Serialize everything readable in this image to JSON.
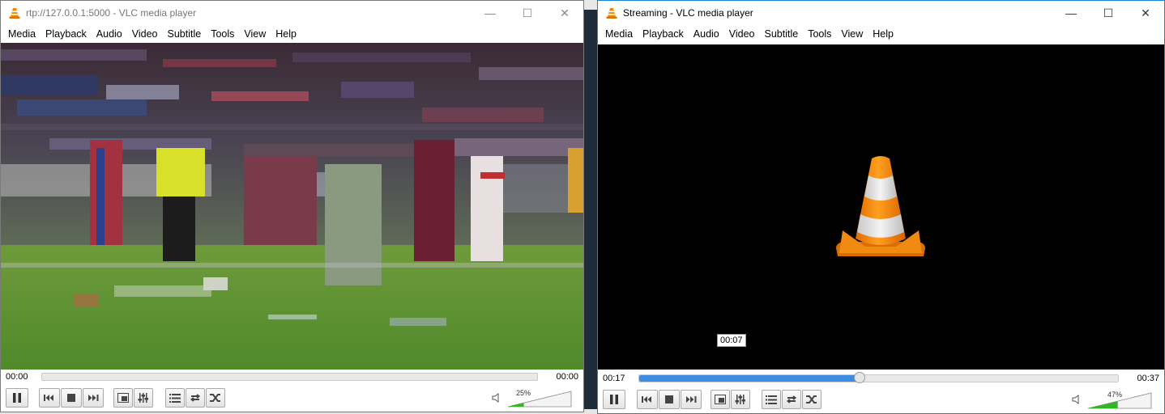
{
  "left_window": {
    "title": "rtp://127.0.0.1:5000 - VLC media player",
    "menu": [
      "Media",
      "Playback",
      "Audio",
      "Video",
      "Subtitle",
      "Tools",
      "View",
      "Help"
    ],
    "time_elapsed": "00:00",
    "time_total": "00:00",
    "seek_fraction": 0,
    "volume_label": "25%",
    "volume_fraction": 0.25
  },
  "right_window": {
    "title": "Streaming - VLC media player",
    "menu": [
      "Media",
      "Playback",
      "Audio",
      "Video",
      "Subtitle",
      "Tools",
      "View",
      "Help"
    ],
    "time_elapsed": "00:17",
    "time_total": "00:37",
    "seek_fraction": 0.46,
    "seek_tooltip": "00:07",
    "volume_label": "47%",
    "volume_fraction": 0.47
  },
  "window_controls": {
    "minimize": "—",
    "maximize": "☐",
    "close": "✕"
  },
  "colors": {
    "accent": "#3d8ee0",
    "volume_green": "#33b526",
    "vlc_orange": "#f18a00"
  },
  "icons": [
    "vlc-cone-icon",
    "pause-icon",
    "previous-icon",
    "stop-icon",
    "next-icon",
    "fullscreen-icon",
    "extended-settings-icon",
    "playlist-icon",
    "loop-icon",
    "shuffle-icon",
    "speaker-icon"
  ]
}
